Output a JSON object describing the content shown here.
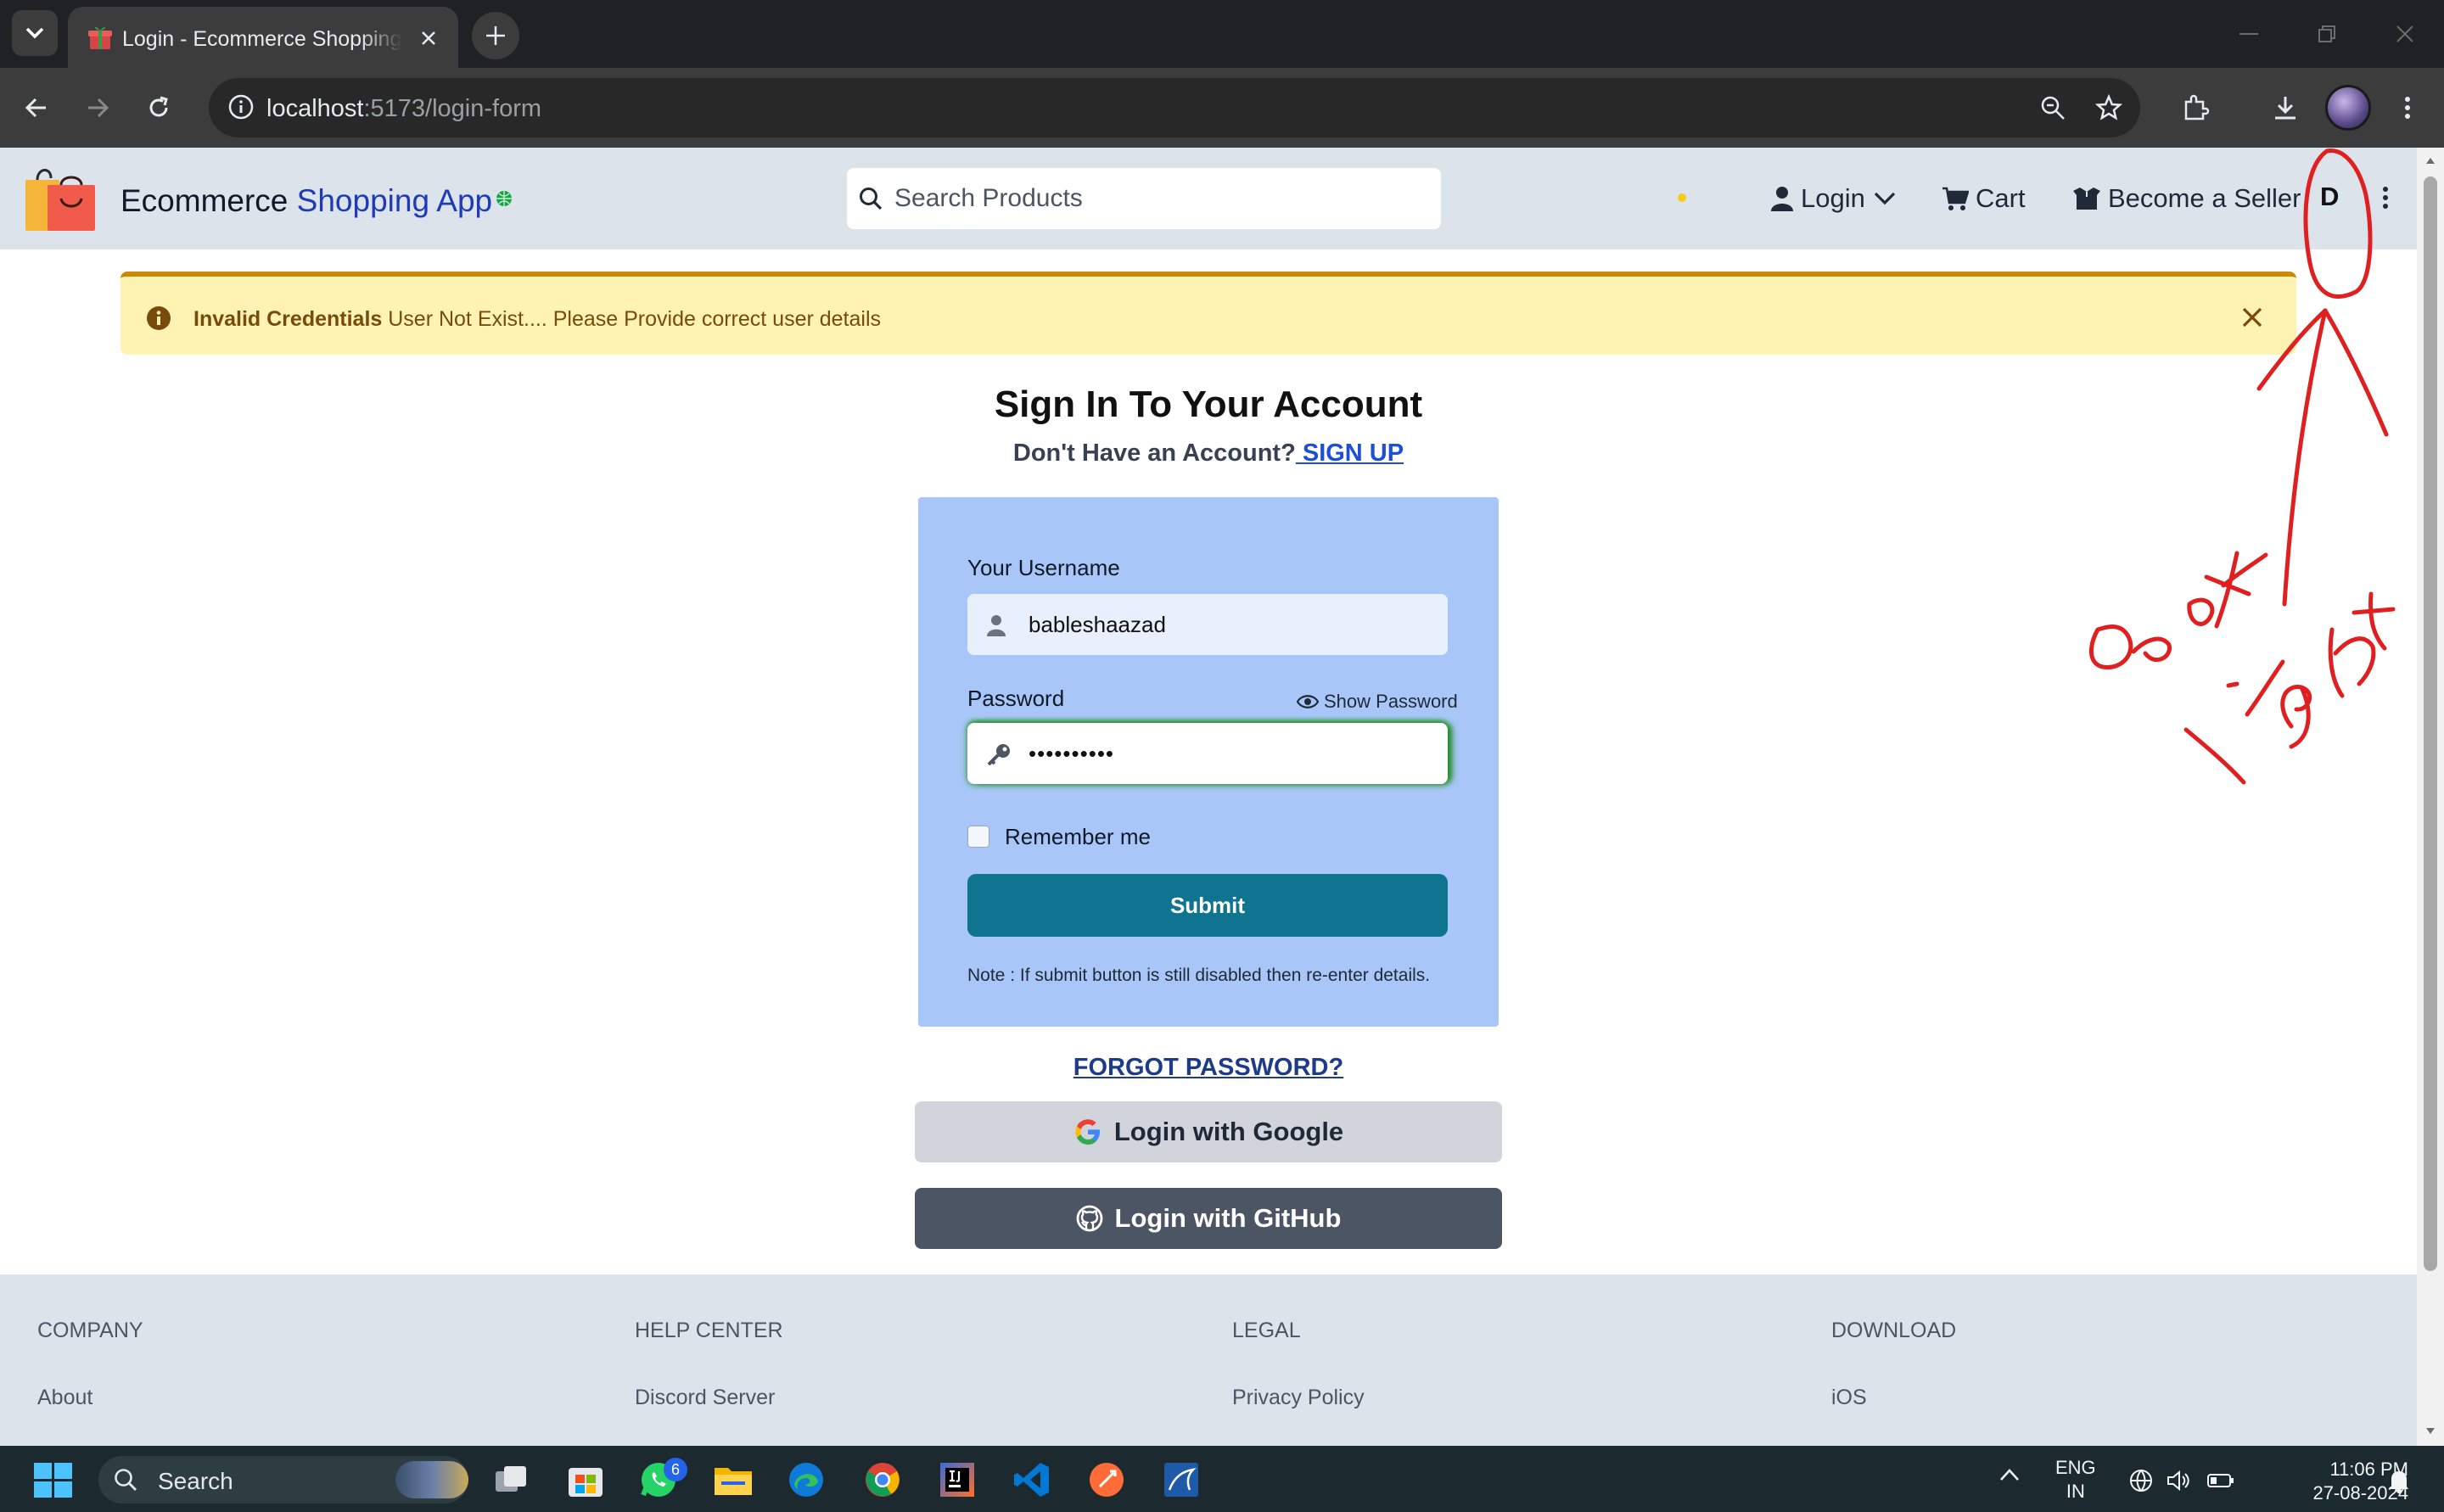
{
  "browser": {
    "tab_title": "Login - Ecommerce Shopping App",
    "url_host": "localhost",
    "url_rest": ":5173/login-form"
  },
  "navbar": {
    "brand_prefix": "Ecommerce ",
    "brand_accent": "Shopping App",
    "search_placeholder": "Search Products",
    "login_label": "Login",
    "cart_label": "Cart",
    "seller_label": "Become a Seller",
    "theme_toggle_label": "D"
  },
  "alert": {
    "title": "Invalid Credentials",
    "message": " User Not Exist.... Please Provide correct user details"
  },
  "page": {
    "heading": "Sign In To Your Account",
    "subheading": "Don't Have an Account?",
    "signup_link": " SIGN UP"
  },
  "form": {
    "username_label": "Your Username",
    "username_value": "bableshaazad",
    "password_label": "Password",
    "show_password_label": "Show Password",
    "password_value": "••••••••••",
    "remember_label": "Remember me",
    "submit_label": "Submit",
    "note": "Note : If submit button is still disabled then re-enter details."
  },
  "auth": {
    "forgot_label": "FORGOT PASSWORD?",
    "google_label": "Login with Google",
    "github_label": "Login with GitHub"
  },
  "footer": {
    "columns": [
      {
        "heading": "COMPANY",
        "first_link": "About"
      },
      {
        "heading": "HELP CENTER",
        "first_link": "Discord Server"
      },
      {
        "heading": "LEGAL",
        "first_link": "Privacy Policy"
      },
      {
        "heading": "DOWNLOAD",
        "first_link": "iOS"
      }
    ]
  },
  "annotation": {
    "words": [
      "Dark",
      "Light"
    ],
    "color": "#e02020"
  },
  "taskbar": {
    "search_label": "Search",
    "whatsapp_badge": "6",
    "lang_line1": "ENG",
    "lang_line2": "IN",
    "time": "11:06 PM",
    "date": "27-08-2024"
  },
  "colors": {
    "navbar_bg": "#dde3ea",
    "alert_bg": "#fef3b3",
    "alert_border": "#c98a06",
    "card_bg": "#a8c7f8",
    "submit_bg": "#0e7490",
    "google_btn_bg": "#d1d5db",
    "github_btn_bg": "#4b5563",
    "link_blue": "#1d4ed8"
  }
}
